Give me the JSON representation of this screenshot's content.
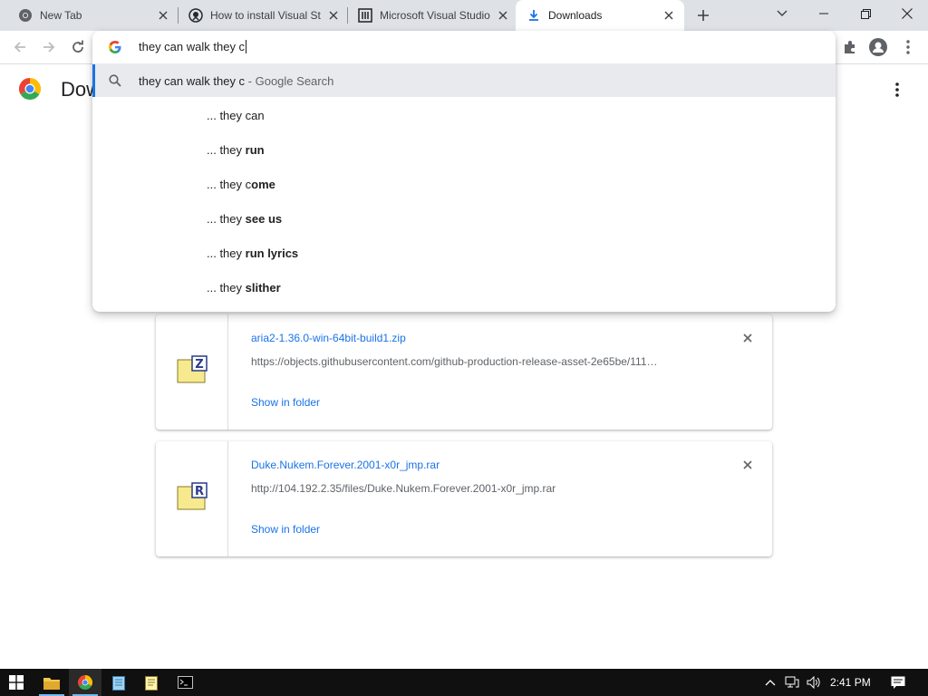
{
  "tabs": [
    {
      "title": "New Tab",
      "icon": "chrome-icon"
    },
    {
      "title": "How to install Visual St",
      "icon": "github-icon"
    },
    {
      "title": "Microsoft Visual Studio",
      "icon": "library-icon"
    },
    {
      "title": "Downloads",
      "icon": "download-icon",
      "active": true
    }
  ],
  "omnibox": {
    "text": "they can walk they c",
    "top_suggestion": {
      "query": "they can walk they c",
      "suffix": " - Google Search"
    },
    "suggestions": [
      {
        "prefix": "... they ",
        "plain": "can",
        "bold": ""
      },
      {
        "prefix": "... they ",
        "plain": "",
        "bold": "run"
      },
      {
        "prefix": "... they ",
        "plain": "c",
        "bold": "ome"
      },
      {
        "prefix": "... they ",
        "plain": "",
        "bold": "see us"
      },
      {
        "prefix": "... they ",
        "plain": "",
        "bold": "run lyrics"
      },
      {
        "prefix": "... they ",
        "plain": "",
        "bold": "slither"
      }
    ]
  },
  "page": {
    "title": "Downloads"
  },
  "downloads": [
    {
      "name": "aria2-1.36.0-win-64bit-build1.zip",
      "url": "https://objects.githubusercontent.com/github-production-release-asset-2e65be/111…",
      "action": "Show in folder",
      "badge": "Z"
    },
    {
      "name": "Duke.Nukem.Forever.2001-x0r_jmp.rar",
      "url": "http://104.192.2.35/files/Duke.Nukem.Forever.2001-x0r_jmp.rar",
      "action": "Show in folder",
      "badge": "R"
    }
  ],
  "taskbar": {
    "time": "2:41 PM"
  },
  "colors": {
    "accent": "#1a73e8",
    "tabstrip": "#dee1e6",
    "taskbar": "#101010"
  }
}
